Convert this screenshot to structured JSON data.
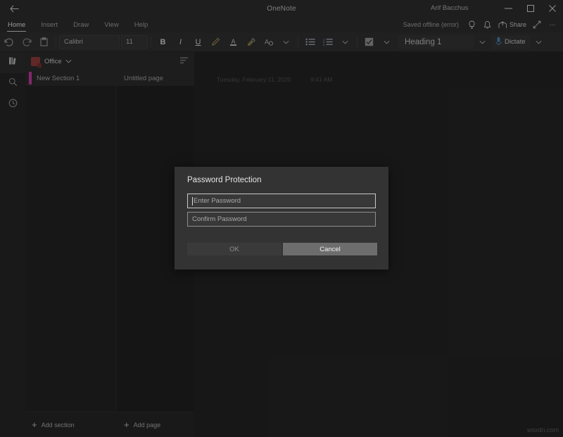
{
  "window": {
    "app_title": "OneNote",
    "user_name": "Arif Bacchus",
    "back_icon": "back-arrow-icon",
    "minimize_label": "─",
    "maximize_label": "□",
    "close_label": "✕"
  },
  "ribbon_tabs": [
    {
      "label": "Home",
      "active": true
    },
    {
      "label": "Insert",
      "active": false
    },
    {
      "label": "Draw",
      "active": false
    },
    {
      "label": "View",
      "active": false
    },
    {
      "label": "Help",
      "active": false
    }
  ],
  "tabrow_right": {
    "save_status": "Saved offline (error)",
    "tellme_icon": "lightbulb-icon",
    "notifications_icon": "bell-icon",
    "share_label": "Share",
    "share_icon": "share-icon",
    "expand_icon": "expand-diagonal-icon",
    "more_label": "···"
  },
  "toolbar": {
    "undo_icon": "undo-icon",
    "redo_icon": "redo-icon",
    "paste_icon": "clipboard-icon",
    "font_name": "Calibri",
    "font_size": "11",
    "bold_label": "B",
    "italic_label": "I",
    "underline_label": "U",
    "pen_icon": "pen-icon",
    "font_color_label": "A",
    "highlight_icon": "highlighter-icon",
    "clear_format_label": "A",
    "format_more_chevron": "chevron-down-icon",
    "bullet_list_icon": "bullet-list-icon",
    "numbered_list_icon": "numbered-list-icon",
    "list_chevron": "chevron-down-icon",
    "todo_icon": "checkbox-icon",
    "todo_chevron": "chevron-down-icon",
    "style_value": "Heading 1",
    "style_chevron": "chevron-down-icon",
    "dictate_label": "Dictate",
    "dictate_icon": "microphone-icon",
    "dictate_chevron": "chevron-down-icon"
  },
  "rail": [
    {
      "name": "notebooks",
      "icon": "books-icon",
      "active": true
    },
    {
      "name": "search",
      "icon": "search-icon",
      "active": false
    },
    {
      "name": "recent",
      "icon": "clock-icon",
      "active": false
    }
  ],
  "navigation": {
    "notebook_name": "Office",
    "notebook_icon": "notebook-icon",
    "notebook_chevron": "chevron-down-icon",
    "sort_icon": "sort-icon",
    "sections": [
      {
        "name": "New Section 1",
        "color": "#c0399f"
      }
    ],
    "pages": [
      {
        "title": "Untitled page"
      }
    ],
    "add_section_label": "Add section",
    "add_page_label": "Add page",
    "add_icon": "plus-icon"
  },
  "canvas": {
    "page_date": "Tuesday, February 11, 2020",
    "page_time": "9:41 AM",
    "watermark": "wsxdn.com"
  },
  "dialog": {
    "title": "Password Protection",
    "enter_password_placeholder": "Enter Password",
    "enter_password_value": "",
    "confirm_password_placeholder": "Confirm Password",
    "confirm_password_value": "",
    "ok_label": "OK",
    "cancel_label": "Cancel"
  },
  "colors": {
    "section_accent": "#c0399f",
    "dialog_bg": "#333333",
    "cancel_button": "#6d6d6d"
  }
}
